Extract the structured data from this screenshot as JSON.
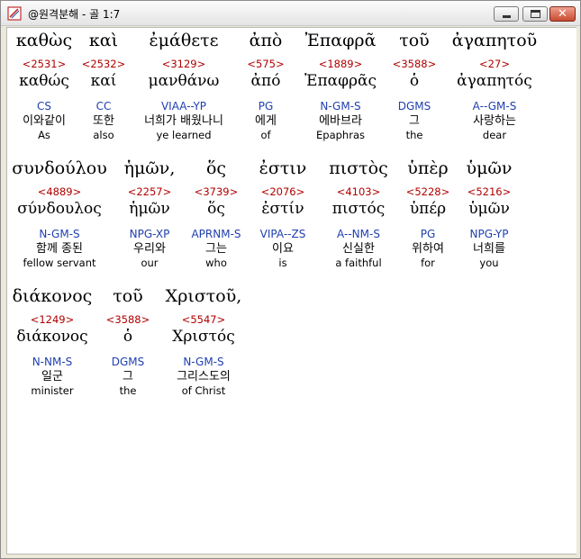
{
  "window": {
    "title": "@원격분해 - 골 1:7"
  },
  "rows": [
    {
      "words": [
        {
          "greek": "καθὼς",
          "strong": "<2531>",
          "lemma": "καθώς",
          "parse": "CS",
          "korean": "이와같이",
          "english": "As"
        },
        {
          "greek": "καὶ",
          "strong": "<2532>",
          "lemma": "καί",
          "parse": "CC",
          "korean": "또한",
          "english": "also"
        },
        {
          "greek": "ἐμάθετε",
          "strong": "<3129>",
          "lemma": "μανθάνω",
          "parse": "VIAA--YP",
          "korean": "너희가 배웠나니",
          "english": "ye learned"
        },
        {
          "greek": "ἀπὸ",
          "strong": "<575>",
          "lemma": "ἀπό",
          "parse": "PG",
          "korean": "에게",
          "english": "of"
        },
        {
          "greek": "Ἐπαφρᾶ",
          "strong": "<1889>",
          "lemma": "Ἐπαφρᾶς",
          "parse": "N-GM-S",
          "korean": "에바브라",
          "english": "Epaphras"
        },
        {
          "greek": "τοῦ",
          "strong": "<3588>",
          "lemma": "ὁ",
          "parse": "DGMS",
          "korean": "그",
          "english": "the"
        },
        {
          "greek": "ἀγαπητοῦ",
          "strong": "<27>",
          "lemma": "ἀγαπητός",
          "parse": "A--GM-S",
          "korean": "사랑하는",
          "english": "dear"
        }
      ]
    },
    {
      "words": [
        {
          "greek": "συνδούλου",
          "strong": "<4889>",
          "lemma": "σύνδουλος",
          "parse": "N-GM-S",
          "korean": "함께 종된",
          "english": "fellow servant"
        },
        {
          "greek": "ἡμῶν,",
          "strong": "<2257>",
          "lemma": "ἡμῶν",
          "parse": "NPG-XP",
          "korean": "우리와",
          "english": "our"
        },
        {
          "greek": "ὅς",
          "strong": "<3739>",
          "lemma": "ὅς",
          "parse": "APRNM-S",
          "korean": "그는",
          "english": "who"
        },
        {
          "greek": "ἐστιν",
          "strong": "<2076>",
          "lemma": "ἐστίν",
          "parse": "VIPA--ZS",
          "korean": "이요",
          "english": "is"
        },
        {
          "greek": "πιστὸς",
          "strong": "<4103>",
          "lemma": "πιστός",
          "parse": "A--NM-S",
          "korean": "신실한",
          "english": "a faithful"
        },
        {
          "greek": "ὑπὲρ",
          "strong": "<5228>",
          "lemma": "ὑπέρ",
          "parse": "PG",
          "korean": "위하여",
          "english": "for"
        },
        {
          "greek": "ὑμῶν",
          "strong": "<5216>",
          "lemma": "ὑμῶν",
          "parse": "NPG-YP",
          "korean": "너희를",
          "english": "you"
        }
      ]
    },
    {
      "words": [
        {
          "greek": "διάκονος",
          "strong": "<1249>",
          "lemma": "διάκονος",
          "parse": "N-NM-S",
          "korean": "일군",
          "english": "minister"
        },
        {
          "greek": "τοῦ",
          "strong": "<3588>",
          "lemma": "ὁ",
          "parse": "DGMS",
          "korean": "그",
          "english": "the"
        },
        {
          "greek": "Χριστοῦ,",
          "strong": "<5547>",
          "lemma": "Χριστός",
          "parse": "N-GM-S",
          "korean": "그리스도의",
          "english": "of Christ"
        }
      ]
    }
  ]
}
